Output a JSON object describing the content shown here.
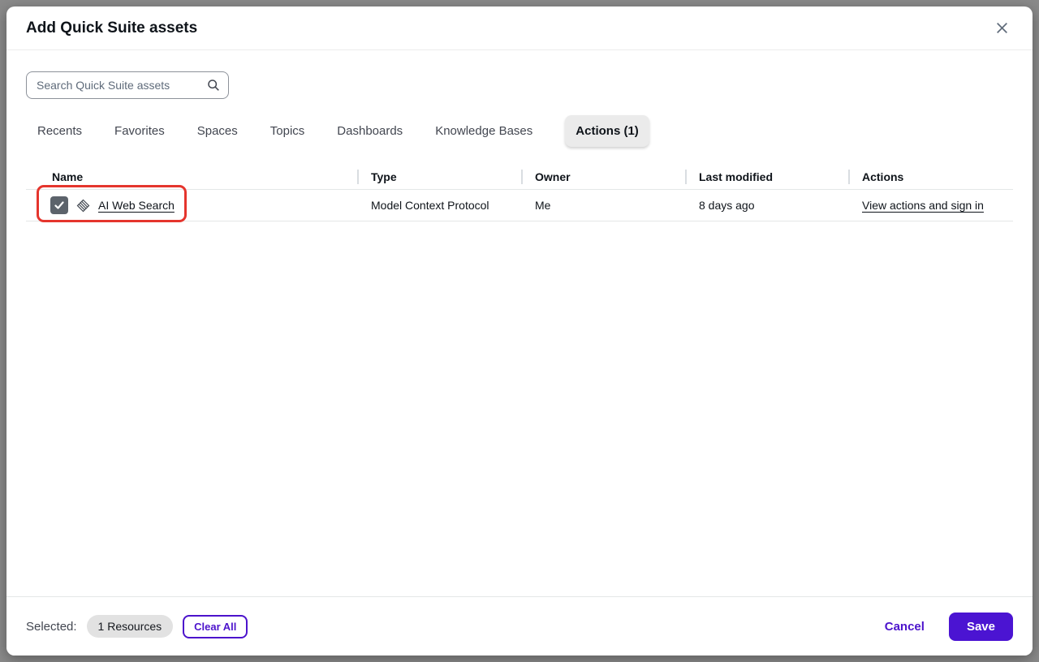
{
  "modal": {
    "title": "Add Quick Suite assets"
  },
  "search": {
    "placeholder": "Search Quick Suite assets",
    "value": ""
  },
  "tabs": [
    {
      "label": "Recents",
      "selected": false
    },
    {
      "label": "Favorites",
      "selected": false
    },
    {
      "label": "Spaces",
      "selected": false
    },
    {
      "label": "Topics",
      "selected": false
    },
    {
      "label": "Dashboards",
      "selected": false
    },
    {
      "label": "Knowledge Bases",
      "selected": false
    },
    {
      "label": "Actions (1)",
      "selected": true
    }
  ],
  "table": {
    "columns": [
      "Name",
      "Type",
      "Owner",
      "Last modified",
      "Actions"
    ],
    "rows": [
      {
        "checked": true,
        "name": "AI Web Search",
        "type": "Model Context Protocol",
        "owner": "Me",
        "last_modified": "8 days ago",
        "action": "View actions and sign in"
      }
    ]
  },
  "annotation": {
    "type": "red-highlight-box",
    "target": "row checkbox and name",
    "color": "#e5352d"
  },
  "footer": {
    "selected_label": "Selected:",
    "selected_badge": "1 Resources",
    "clear_all_label": "Clear All",
    "cancel_label": "Cancel",
    "save_label": "Save"
  },
  "icons": {
    "close": "x-icon",
    "search": "magnifier-icon",
    "asset": "mcp-hatched-icon",
    "checkbox": "checkmark-icon"
  },
  "colors": {
    "accent": "#4b14d2",
    "highlight": "#e5352d",
    "backdrop": "#8a8a8a",
    "selected_tab_bg": "#ebebeb",
    "checkbox_bg": "#5c636b"
  }
}
